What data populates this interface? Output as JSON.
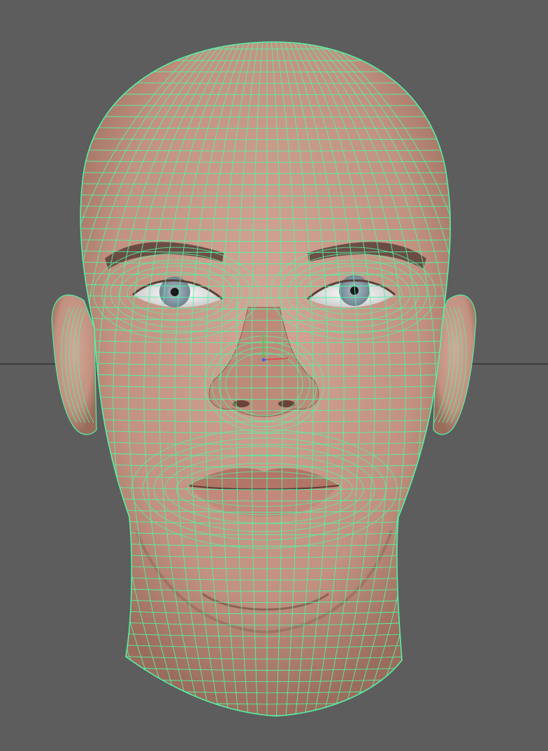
{
  "viewport": {
    "background_color": "#5d5d5d",
    "wireframe_color": "#54f2a6",
    "skin_color": "#c99a87",
    "skin_shadow_color": "#9f7262",
    "ground_grid_color": "#3c3c3c",
    "iris_color": "#8fa0ad",
    "axis_colors": {
      "x": "#e04040",
      "y": "#40d040",
      "z": "#4060ff"
    },
    "object_icon": "head-mesh-icon",
    "axis_icon": "view-axis-icon"
  }
}
